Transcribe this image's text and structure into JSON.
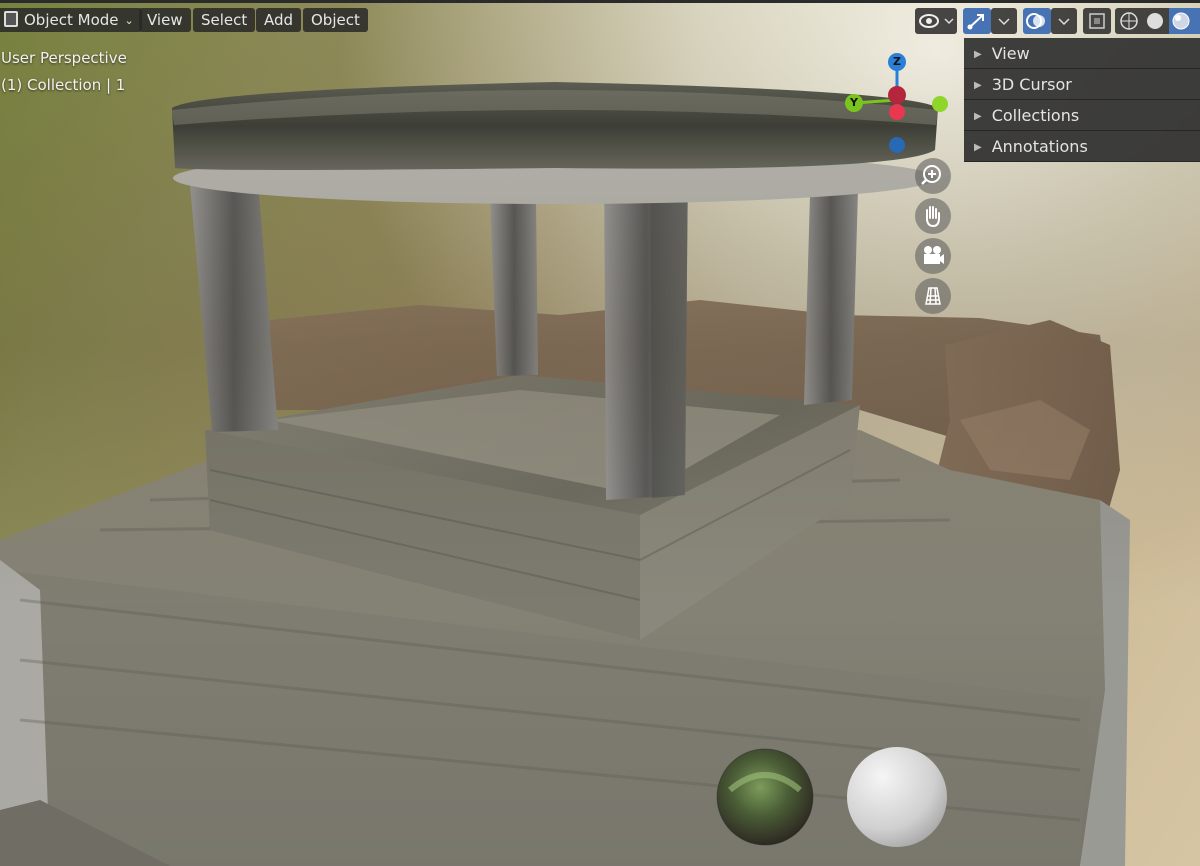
{
  "header": {
    "mode_label": "Object Mode",
    "menus": [
      "View",
      "Select",
      "Add",
      "Object"
    ]
  },
  "viewport": {
    "perspective_label": "User Perspective",
    "collection_label": "(1) Collection | 1"
  },
  "sidebar_panels": [
    "View",
    "3D Cursor",
    "Collections",
    "Annotations"
  ],
  "gizmo": {
    "z_label": "Z",
    "y_label": "Y"
  },
  "colors": {
    "accent": "#4772b3",
    "x_axis": "#e8374f",
    "y_axis": "#7ac41f",
    "z_axis": "#2a7fd9"
  },
  "icons": [
    "visibility-icon",
    "gizmo-icon",
    "overlay-icon",
    "xray-icon",
    "wireframe-icon",
    "solid-icon",
    "material-icon",
    "zoom-icon",
    "pan-hand-icon",
    "camera-icon",
    "ortho-grid-icon"
  ]
}
